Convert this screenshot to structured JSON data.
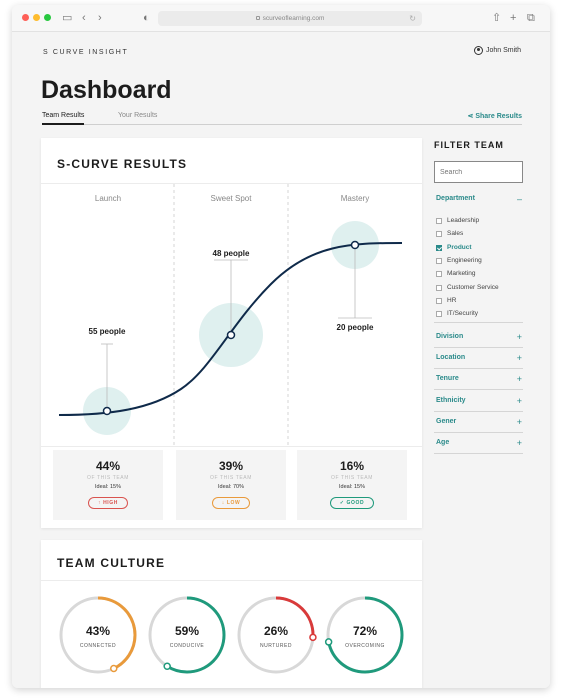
{
  "browser": {
    "url": "scurveoflearning.com",
    "colors": {
      "close": "#fe5f57",
      "minimize": "#febc2e",
      "maximize": "#28c840"
    }
  },
  "app": {
    "brand": "S CURVE INSIGHT",
    "user_name": "John Smith",
    "page_title": "Dashboard",
    "tabs": [
      {
        "label": "Team Results",
        "active": true
      },
      {
        "label": "Your Results",
        "active": false
      }
    ],
    "share_label": "Share Results"
  },
  "scurve": {
    "title": "S-CURVE RESULTS",
    "stages": [
      "Launch",
      "Sweet Spot",
      "Mastery"
    ],
    "callouts": [
      {
        "label": "55 people"
      },
      {
        "label": "48 people"
      },
      {
        "label": "20 people"
      }
    ],
    "stats": [
      {
        "pct": "44%",
        "sub": "OF THIS TEAM",
        "ideal": "Ideal: 15%",
        "badge": "HIGH",
        "badge_icon": "↑",
        "color": "#d9534f"
      },
      {
        "pct": "39%",
        "sub": "OF THIS TEAM",
        "ideal": "Ideal: 70%",
        "badge": "LOW",
        "badge_icon": "↓",
        "color": "#e99a3b"
      },
      {
        "pct": "16%",
        "sub": "OF THIS TEAM",
        "ideal": "Ideal: 15%",
        "badge": "GOOD",
        "badge_icon": "✓",
        "color": "#1f9a7c"
      }
    ],
    "colors": {
      "curve": "#0f2a4a",
      "bubble": "#dff0ef"
    }
  },
  "culture": {
    "title": "TEAM CULTURE",
    "rings": [
      {
        "pct": "43%",
        "label": "CONNECTED",
        "value": 0.43,
        "color": "#e99a3b"
      },
      {
        "pct": "59%",
        "label": "CONDUCIVE",
        "value": 0.59,
        "color": "#1f9a7c"
      },
      {
        "pct": "26%",
        "label": "NURTURED",
        "value": 0.26,
        "color": "#d93a3a"
      },
      {
        "pct": "72%",
        "label": "OVERCOMING",
        "value": 0.72,
        "color": "#1f9a7c"
      }
    ]
  },
  "filter": {
    "title": "FILTER TEAM",
    "search_placeholder": "Search",
    "department": {
      "label": "Department",
      "sign": "–",
      "options": [
        {
          "label": "Leadership",
          "checked": false
        },
        {
          "label": "Sales",
          "checked": false
        },
        {
          "label": "Product",
          "checked": true
        },
        {
          "label": "Engineering",
          "checked": false
        },
        {
          "label": "Marketing",
          "checked": false
        },
        {
          "label": "Customer Service",
          "checked": false
        },
        {
          "label": "HR",
          "checked": false
        },
        {
          "label": "IT/Security",
          "checked": false
        }
      ]
    },
    "groups": [
      {
        "label": "Division",
        "sign": "+"
      },
      {
        "label": "Location",
        "sign": "+"
      },
      {
        "label": "Tenure",
        "sign": "+"
      },
      {
        "label": "Ethnicity",
        "sign": "+"
      },
      {
        "label": "Gener",
        "sign": "+"
      },
      {
        "label": "Age",
        "sign": "+"
      }
    ]
  }
}
